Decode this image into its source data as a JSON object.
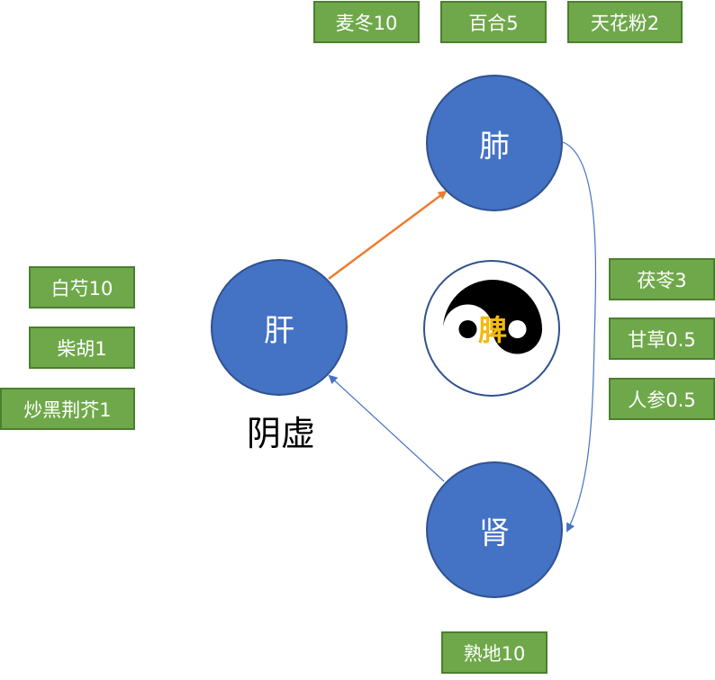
{
  "organs": {
    "liver": "肝",
    "lung": "肺",
    "kidney": "肾",
    "spleen": "脾"
  },
  "caption": "阴虚",
  "herbs": {
    "top": [
      "麦冬10",
      "百合5",
      "天花粉2"
    ],
    "left": [
      "白芍10",
      "柴胡1",
      "炒黑荆芥1"
    ],
    "right": [
      "茯苓3",
      "甘草0.5",
      "人参0.5"
    ],
    "bottom": [
      "熟地10"
    ]
  },
  "colors": {
    "organ_fill": "#4472c4",
    "herb_fill": "#6fa84a",
    "liver_to_lung_arrow": "#ed7d31",
    "other_arrows": "#4472c4",
    "spleen_label": "#f2b90f"
  }
}
